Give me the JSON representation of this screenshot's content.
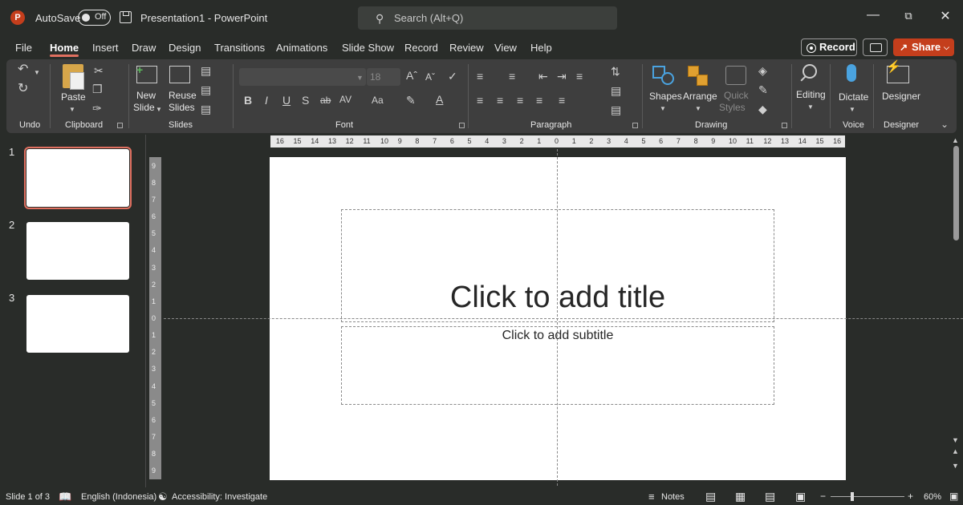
{
  "titlebar": {
    "autosave_label": "AutoSave",
    "autosave_state": "Off",
    "doc_title": "Presentation1  -  PowerPoint",
    "search_placeholder": "Search (Alt+Q)"
  },
  "menu": {
    "tabs": [
      "File",
      "Home",
      "Insert",
      "Draw",
      "Design",
      "Transitions",
      "Animations",
      "Slide Show",
      "Record",
      "Review",
      "View",
      "Help"
    ],
    "active": "Home",
    "record_label": "Record",
    "share_label": "Share"
  },
  "ribbon": {
    "groups": {
      "undo": "Undo",
      "clipboard": "Clipboard",
      "slides": "Slides",
      "font": "Font",
      "paragraph": "Paragraph",
      "drawing": "Drawing",
      "voice": "Voice",
      "designer": "Designer"
    },
    "paste": "Paste",
    "new_slide_1": "New",
    "new_slide_2": "Slide",
    "reuse_1": "Reuse",
    "reuse_2": "Slides",
    "font_size": "18",
    "shapes": "Shapes",
    "arrange": "Arrange",
    "quick_1": "Quick",
    "quick_2": "Styles",
    "editing": "Editing",
    "dictate": "Dictate",
    "designer": "Designer"
  },
  "thumbnails": [
    "1",
    "2",
    "3"
  ],
  "slide": {
    "title_placeholder": "Click to add title",
    "subtitle_placeholder": "Click to add subtitle"
  },
  "ruler": {
    "h": [
      "16",
      "15",
      "14",
      "13",
      "12",
      "11",
      "10",
      "9",
      "8",
      "7",
      "6",
      "5",
      "4",
      "3",
      "2",
      "1",
      "0",
      "1",
      "2",
      "3",
      "4",
      "5",
      "6",
      "7",
      "8",
      "9",
      "10",
      "11",
      "12",
      "13",
      "14",
      "15",
      "16"
    ],
    "v": [
      "9",
      "8",
      "7",
      "6",
      "5",
      "4",
      "3",
      "2",
      "1",
      "0",
      "1",
      "2",
      "3",
      "4",
      "5",
      "6",
      "7",
      "8",
      "9"
    ]
  },
  "status": {
    "slide_info": "Slide 1 of 3",
    "language": "English (Indonesia)",
    "accessibility": "Accessibility: Investigate",
    "notes": "Notes",
    "zoom": "60%"
  }
}
